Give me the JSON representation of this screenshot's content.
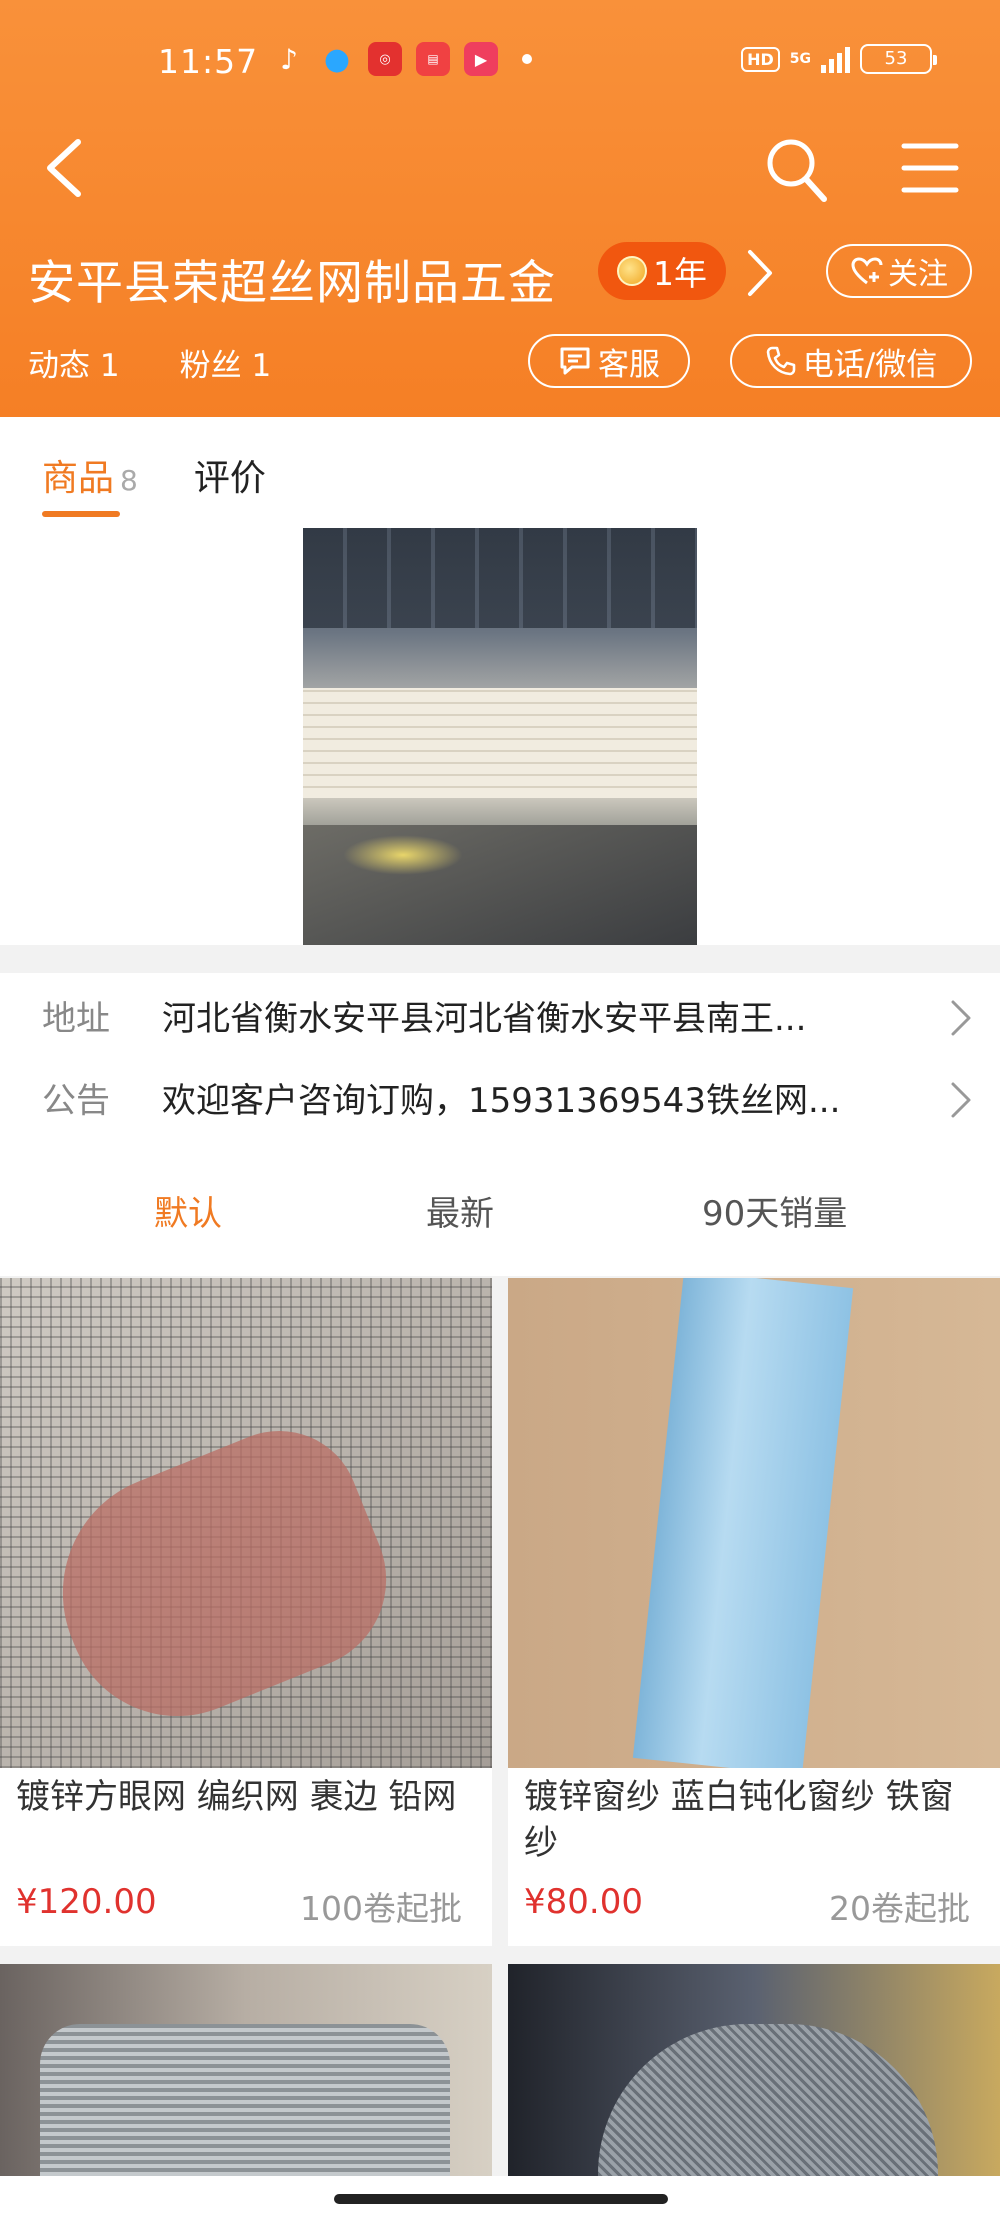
{
  "status_bar": {
    "time": "11:57",
    "signal": "5G",
    "hd": "HD",
    "battery": "53"
  },
  "header": {
    "shop_name": "安平县荣超丝网制品五金",
    "year_badge": "1年",
    "follow_label": "关注",
    "stats": [
      {
        "label": "动态",
        "value": "1"
      },
      {
        "label": "粉丝",
        "value": "1"
      }
    ],
    "service_label": "客服",
    "phone_label": "电话/微信",
    "accent_color": "#f57f25"
  },
  "tabs": {
    "products_label": "商品",
    "products_count": "8",
    "reviews_label": "评价"
  },
  "info": {
    "address_label": "地址",
    "address_text": "河北省衡水安平县河北省衡水安平县南王...",
    "notice_label": "公告",
    "notice_text": "欢迎客户咨询订购，15931369543铁丝网..."
  },
  "sort": {
    "default_label": "默认",
    "newest_label": "最新",
    "sales_label": "90天销量"
  },
  "products": [
    {
      "title": "镀锌方眼网 编织网 裹边 铅网",
      "price": "¥120.00",
      "moq": "100卷起批"
    },
    {
      "title": "镀锌窗纱 蓝白钝化窗纱 铁窗纱",
      "price": "¥80.00",
      "moq": "20卷起批"
    }
  ]
}
